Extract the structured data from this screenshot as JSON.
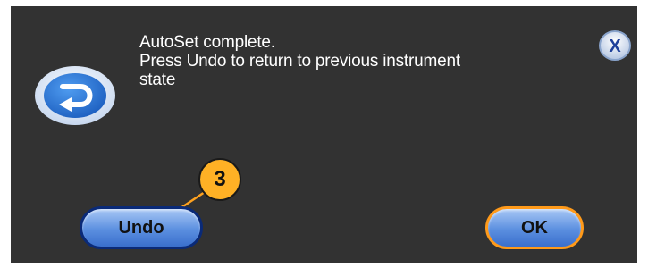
{
  "dialog": {
    "icon": "undo-arrow-icon",
    "message_line1": "AutoSet complete.",
    "message_line2": "Press Undo to return to previous instrument",
    "message_line3": "state",
    "close_icon": "x-close-icon",
    "close_label": "X",
    "undo_label": "Undo",
    "ok_label": "OK"
  },
  "callout": {
    "number": "3"
  },
  "colors": {
    "dialog_background": "#323232",
    "message_text": "#ffffff",
    "button_blue": "#5b8fe0",
    "undo_border": "#0a2a78",
    "ok_border": "#ff9a1a",
    "callout_fill": "#ffb125"
  }
}
